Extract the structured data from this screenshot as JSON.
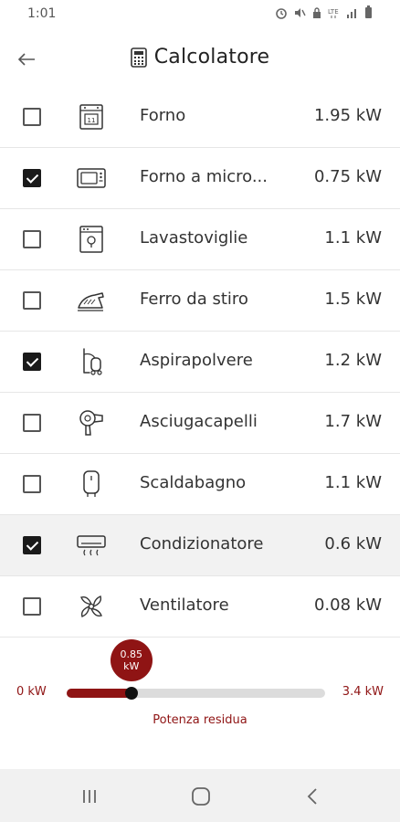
{
  "status_bar": {
    "time": "1:01"
  },
  "header": {
    "title": "Calcolatore"
  },
  "appliances": [
    {
      "name": "Forno",
      "power": "1.95 kW",
      "checked": false,
      "icon": "oven-icon"
    },
    {
      "name": "Forno a micro...",
      "power": "0.75 kW",
      "checked": true,
      "icon": "microwave-icon"
    },
    {
      "name": "Lavastoviglie",
      "power": "1.1 kW",
      "checked": false,
      "icon": "dishwasher-icon"
    },
    {
      "name": "Ferro da stiro",
      "power": "1.5 kW",
      "checked": false,
      "icon": "iron-icon"
    },
    {
      "name": "Aspirapolvere",
      "power": "1.2 kW",
      "checked": true,
      "icon": "vacuum-icon"
    },
    {
      "name": "Asciugacapelli",
      "power": "1.7 kW",
      "checked": false,
      "icon": "hairdryer-icon"
    },
    {
      "name": "Scaldabagno",
      "power": "1.1 kW",
      "checked": false,
      "icon": "water-heater-icon"
    },
    {
      "name": "Condizionatore",
      "power": "0.6 kW",
      "checked": true,
      "icon": "air-conditioner-icon"
    },
    {
      "name": "Ventilatore",
      "power": "0.08 kW",
      "checked": false,
      "icon": "fan-icon"
    }
  ],
  "power_meter": {
    "value_label_line1": "0.85",
    "value_label_line2": "kW",
    "min_label": "0 kW",
    "max_label": "3.4 kW",
    "fraction": 0.25,
    "caption": "Potenza residua",
    "accent_color": "#8f1414"
  }
}
